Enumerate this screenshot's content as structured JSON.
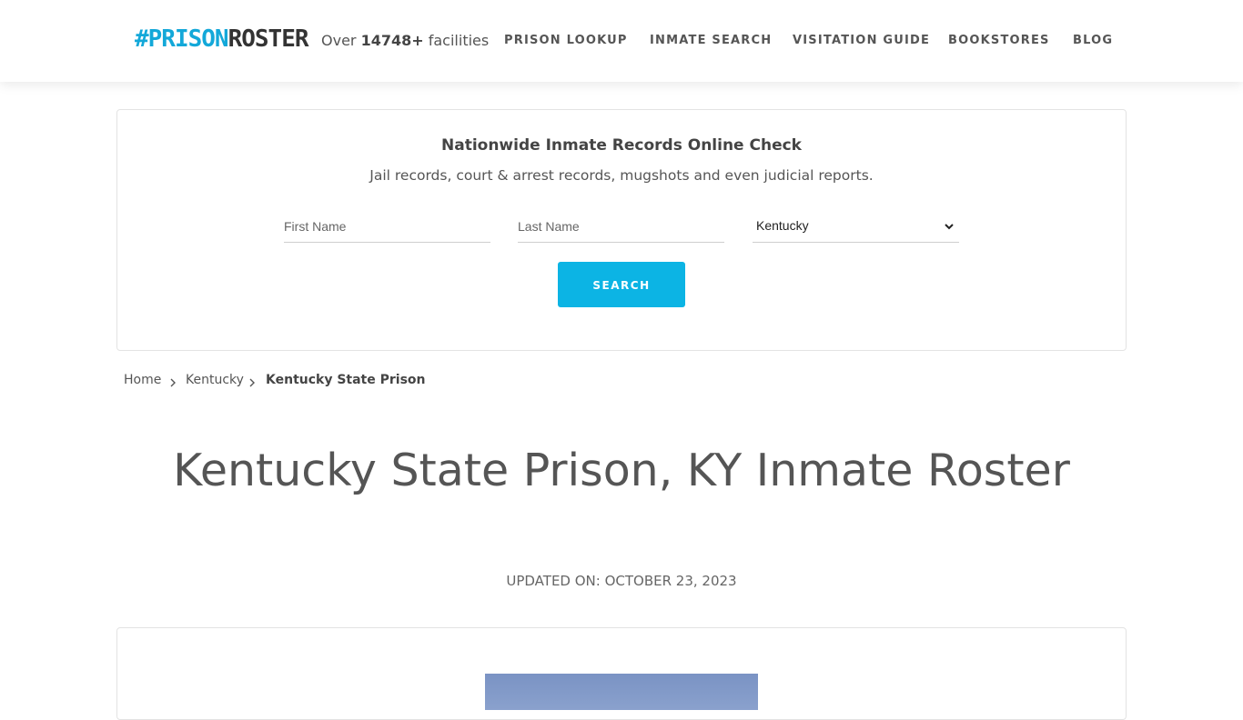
{
  "header": {
    "logo_prefix": "#PRISON",
    "logo_suffix": "ROSTER",
    "facilities_before": "Over ",
    "facilities_count": "14748+",
    "facilities_after": " facilities",
    "nav": [
      {
        "label": "PRISON LOOKUP"
      },
      {
        "label": "INMATE SEARCH"
      },
      {
        "label": "VISITATION GUIDE"
      },
      {
        "label": "BOOKSTORES"
      },
      {
        "label": "BLOG"
      }
    ]
  },
  "search_card": {
    "title": "Nationwide Inmate Records Online Check",
    "subtitle": "Jail records, court & arrest records, mugshots and even judicial reports.",
    "first_name_placeholder": "First Name",
    "last_name_placeholder": "Last Name",
    "state_selected": "Kentucky",
    "search_label": "SEARCH"
  },
  "breadcrumb": {
    "items": [
      {
        "label": "Home"
      },
      {
        "label": "Kentucky"
      },
      {
        "label": "Kentucky State Prison"
      }
    ]
  },
  "page": {
    "title": "Kentucky State Prison, KY Inmate Roster",
    "updated": "UPDATED ON: OCTOBER 23, 2023"
  },
  "colors": {
    "accent": "#0cb4e4",
    "logo_accent": "#13a8d9",
    "text": "#555555"
  },
  "icons": {
    "select_chevron": "chevron-down-icon",
    "breadcrumb_separator": "chevron-right-icon"
  }
}
